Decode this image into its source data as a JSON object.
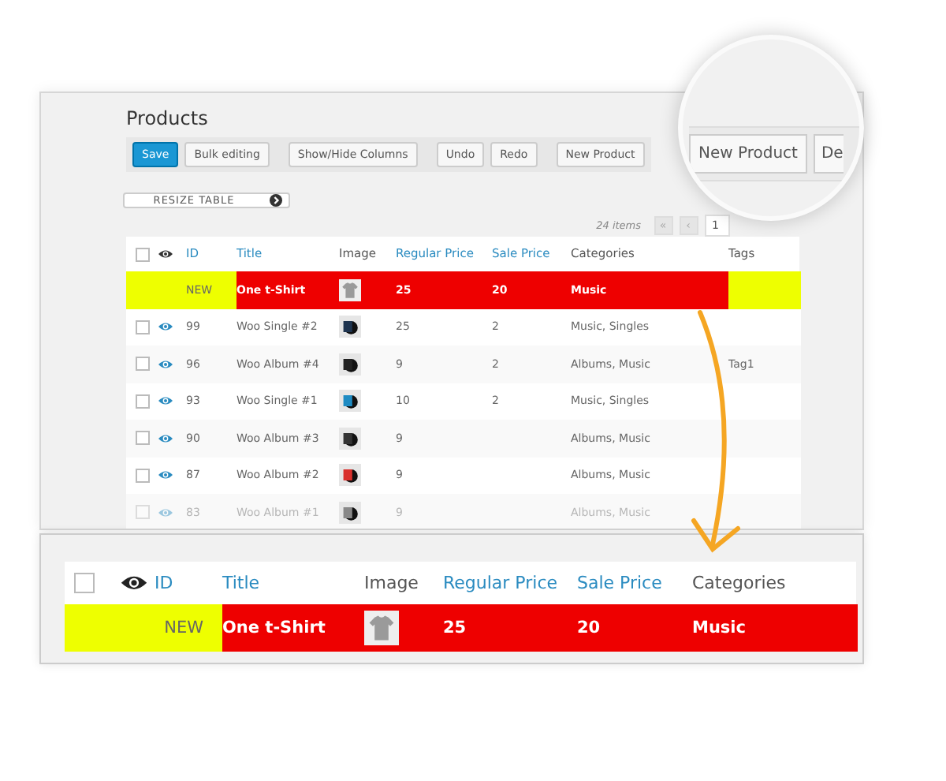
{
  "screen": {
    "title": "Products",
    "toolbar_groups": [
      [
        {
          "label": "Save",
          "kind": "primary"
        },
        {
          "label": "Bulk editing",
          "kind": "plain"
        }
      ],
      [
        {
          "label": "Show/Hide Columns",
          "kind": "plain"
        }
      ],
      [
        {
          "label": "Undo",
          "kind": "plain"
        },
        {
          "label": "Redo",
          "kind": "plain"
        }
      ],
      [
        {
          "label": "New Product",
          "kind": "plain"
        }
      ]
    ],
    "resize_button": "RESIZE TABLE",
    "pagination": {
      "count": "24 items",
      "first": "«",
      "prev": "‹",
      "page": "1"
    },
    "table": {
      "select_all_checked": false,
      "columns": [
        {
          "label": "ID",
          "sortable": true
        },
        {
          "label": "Title",
          "sortable": true
        },
        {
          "label": "Image",
          "sortable": false
        },
        {
          "label": "Regular Price",
          "sortable": true
        },
        {
          "label": "Sale Price",
          "sortable": true
        },
        {
          "label": "Categories",
          "sortable": false
        },
        {
          "label": "Tags",
          "sortable": false
        }
      ],
      "rows": [
        {
          "new": true,
          "faded": false,
          "kind": "shirt",
          "color": "#9a9a9a",
          "id": "NEW",
          "title": "One t-Shirt",
          "regular_price": "25",
          "sale_price": "20",
          "categories": "Music",
          "tags": ""
        },
        {
          "new": false,
          "faded": false,
          "checked": false,
          "kind": "disc",
          "color": "#1f3550",
          "id": "99",
          "title": "Woo Single #2",
          "regular_price": "25",
          "sale_price": "2",
          "categories": "Music, Singles",
          "tags": ""
        },
        {
          "new": false,
          "faded": false,
          "checked": false,
          "kind": "disc",
          "color": "#222222",
          "id": "96",
          "title": "Woo Album #4",
          "regular_price": "9",
          "sale_price": "2",
          "categories": "Albums, Music",
          "tags": "Tag1"
        },
        {
          "new": false,
          "faded": false,
          "checked": false,
          "kind": "disc",
          "color": "#1e8bc3",
          "id": "93",
          "title": "Woo Single #1",
          "regular_price": "10",
          "sale_price": "2",
          "categories": "Music, Singles",
          "tags": ""
        },
        {
          "new": false,
          "faded": false,
          "checked": false,
          "kind": "disc",
          "color": "#333333",
          "id": "90",
          "title": "Woo Album #3",
          "regular_price": "9",
          "sale_price": "",
          "categories": "Albums, Music",
          "tags": ""
        },
        {
          "new": false,
          "faded": false,
          "checked": false,
          "kind": "disc",
          "color": "#d9302c",
          "id": "87",
          "title": "Woo Album #2",
          "regular_price": "9",
          "sale_price": "",
          "categories": "Albums, Music",
          "tags": ""
        },
        {
          "new": false,
          "faded": true,
          "checked": false,
          "kind": "disc",
          "color": "#888888",
          "id": "83",
          "title": "Woo Album #1",
          "regular_price": "9",
          "sale_price": "",
          "categories": "Albums, Music",
          "tags": ""
        }
      ]
    }
  },
  "magnifier": {
    "buttons": [
      "New Product",
      "De"
    ]
  },
  "zoom_panel": {
    "select_all_checked": false,
    "columns": [
      {
        "label": "ID",
        "sortable": true
      },
      {
        "label": "Title",
        "sortable": true
      },
      {
        "label": "Image",
        "sortable": false
      },
      {
        "label": "Regular Price",
        "sortable": true
      },
      {
        "label": "Sale Price",
        "sortable": true
      },
      {
        "label": "Categories",
        "sortable": false
      }
    ],
    "row": {
      "new": true,
      "kind": "shirt",
      "color": "#9a9a9a",
      "id": "NEW",
      "title": "One t-Shirt",
      "regular_price": "25",
      "sale_price": "20",
      "categories": "Music"
    }
  }
}
